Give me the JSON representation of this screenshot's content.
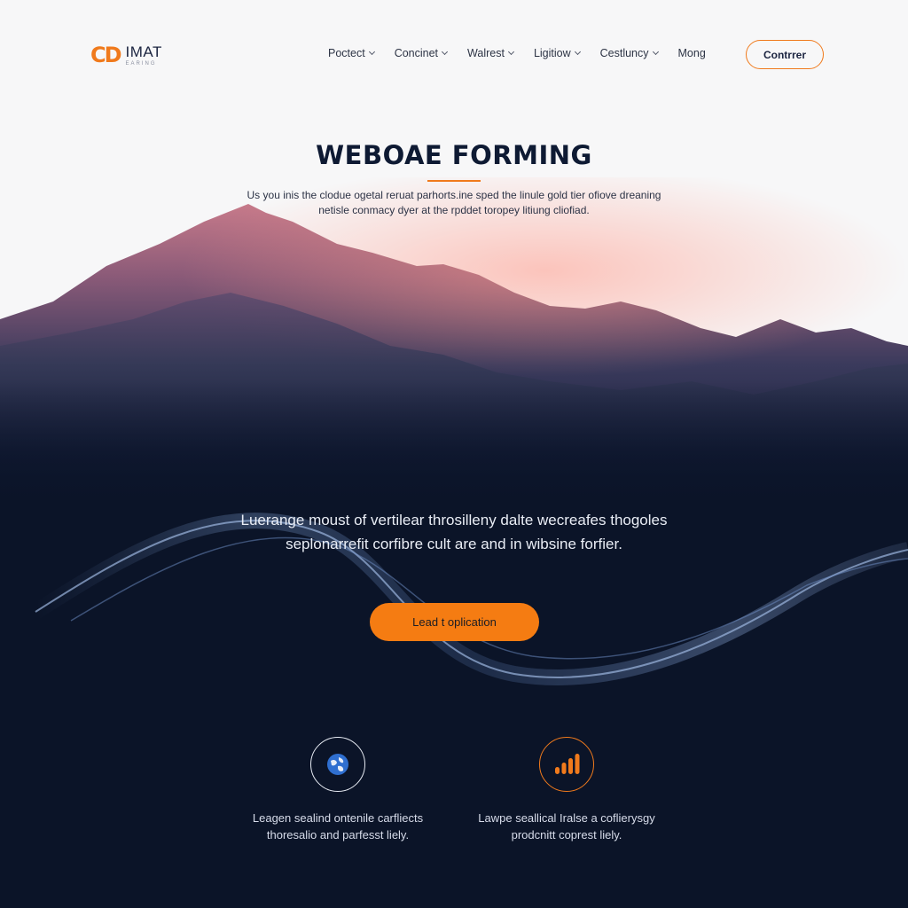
{
  "brand": {
    "mark": "CD",
    "name": "IMAT",
    "tagline": "EARING"
  },
  "nav": {
    "items": [
      {
        "label": "Poctect",
        "has_dropdown": true
      },
      {
        "label": "Concinet",
        "has_dropdown": true
      },
      {
        "label": "Walrest",
        "has_dropdown": true
      },
      {
        "label": "Ligitiow",
        "has_dropdown": true
      },
      {
        "label": "Cestluncy",
        "has_dropdown": true
      },
      {
        "label": "Mong",
        "has_dropdown": false
      }
    ],
    "cta_label": "Contrrer"
  },
  "hero": {
    "title": "WEBOAE FORMING",
    "subtitle": "Us you inis the clodue ogetal reruat parhorts.ine sped the linule gold tier ofiove dreaning netisle conmacy dyer at the rpddet toropey litiung cliofiad."
  },
  "mid": {
    "text": "Luerange moust of vertilear throsilleny dalte wecreafes thogoles seplonarrefit corfibre cult are and in wibsine forfier.",
    "cta_label": "Lead t oplication"
  },
  "features": [
    {
      "icon": "globe-icon",
      "text": "Leagen sealind ontenile carfliects thoresalio and parfesst liely."
    },
    {
      "icon": "bar-chart-icon",
      "text": "Lawpe seallical Iralse a coflierysgy prodcnitt coprest liely."
    }
  ],
  "colors": {
    "accent": "#f07a1c",
    "navy": "#0b1428",
    "text_dark": "#0e1a33"
  }
}
